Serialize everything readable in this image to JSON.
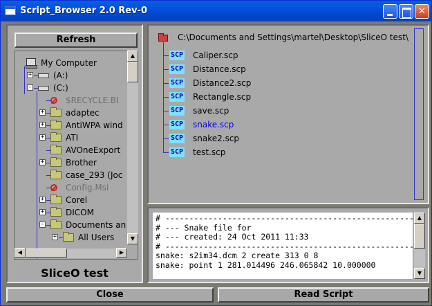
{
  "window": {
    "title": "Script_Browser 2.0 Rev-0"
  },
  "left_panel": {
    "refresh_label": "Refresh",
    "caption": "SliceO test",
    "tree": [
      {
        "label": "My Computer",
        "icon": "computer-icon",
        "muted": false
      },
      {
        "label": "(A:)",
        "icon": "floppy-drive-icon",
        "muted": false
      },
      {
        "label": "(C:)",
        "icon": "hard-drive-icon",
        "muted": false
      },
      {
        "label": "$RECYCLE.BI",
        "icon": "no-access-folder-icon",
        "muted": true
      },
      {
        "label": "adaptec",
        "icon": "folder-icon",
        "muted": false
      },
      {
        "label": "AntiWPA wind",
        "icon": "folder-icon",
        "muted": false
      },
      {
        "label": "ATI",
        "icon": "folder-icon",
        "muted": false
      },
      {
        "label": "AVOneExport",
        "icon": "folder-icon",
        "muted": false
      },
      {
        "label": "Brother",
        "icon": "folder-icon",
        "muted": false
      },
      {
        "label": "case_293 (Joc",
        "icon": "folder-icon",
        "muted": false
      },
      {
        "label": "Config.Msi",
        "icon": "no-access-folder-icon",
        "muted": true
      },
      {
        "label": "Corel",
        "icon": "folder-icon",
        "muted": false
      },
      {
        "label": "DICOM",
        "icon": "folder-icon",
        "muted": false
      },
      {
        "label": "Documents an",
        "icon": "folder-icon",
        "muted": false
      },
      {
        "label": "All Users",
        "icon": "folder-icon",
        "muted": false
      }
    ]
  },
  "file_list": {
    "directory": "C:\\Documents and Settings\\martel\\Desktop\\SliceO test\\",
    "file_badge": "SCP",
    "selected_index": 5,
    "files": [
      "Caliper.scp",
      "Distance.scp",
      "Distance2.scp",
      "Rectangle.scp",
      "save.scp",
      "snake.scp",
      "snake2.scp",
      "test.scp"
    ]
  },
  "script_preview": {
    "lines": [
      "# -------------------------------------------------------",
      "# --- Snake file for                                   ",
      "# --- created: 24 Oct 2011 11:33",
      "# -------------------------------------------------------",
      "",
      "snake: s2im34.dcm 2 create 313 0 8",
      "snake: point 1 281.014496 246.065842 10.000000"
    ],
    "marker": "*"
  },
  "buttons": {
    "close_label": "Close",
    "read_label": "Read Script"
  },
  "colors": {
    "title_bar": "#0653e0",
    "panel": "#a9a9a9",
    "tree_line": "#3030d0",
    "selected_file": "#0000ee",
    "scp_badge_bg": "#7fe0ff"
  }
}
